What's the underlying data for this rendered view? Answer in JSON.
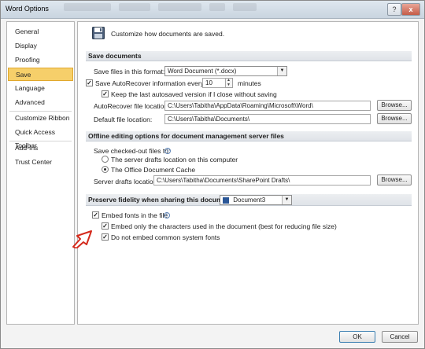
{
  "window": {
    "title": "Word Options",
    "help_label": "?",
    "close_label": "x"
  },
  "nav": {
    "items": [
      {
        "label": "General"
      },
      {
        "label": "Display"
      },
      {
        "label": "Proofing"
      },
      {
        "label": "Save",
        "selected": true
      },
      {
        "label": "Language"
      },
      {
        "label": "Advanced"
      },
      {
        "label": "Customize Ribbon"
      },
      {
        "label": "Quick Access Toolbar"
      },
      {
        "label": "Add-Ins"
      },
      {
        "label": "Trust Center"
      }
    ]
  },
  "header": {
    "icon": "save-floppy-icon",
    "text": "Customize how documents are saved."
  },
  "save_documents": {
    "section_title": "Save documents",
    "format_label": "Save files in this format:",
    "format_value": "Word Document (*.docx)",
    "autorecover_label": "Save AutoRecover information every",
    "autorecover_checked": true,
    "autorecover_minutes": "10",
    "minutes_label": "minutes",
    "keep_last_label": "Keep the last autosaved version if I close without saving",
    "keep_last_checked": true,
    "autorecover_location_label": "AutoRecover file location:",
    "autorecover_location_value": "C:\\Users\\Tabitha\\AppData\\Roaming\\Microsoft\\Word\\",
    "default_location_label": "Default file location:",
    "default_location_value": "C:\\Users\\Tabitha\\Documents\\",
    "browse_label": "Browse..."
  },
  "offline": {
    "section_title": "Offline editing options for document management server files",
    "checked_out_label": "Save checked-out files to:",
    "radio_server_label": "The server drafts location on this computer",
    "radio_cache_label": "The Office Document Cache",
    "selected": "cache",
    "drafts_label": "Server drafts location:",
    "drafts_value": "C:\\Users\\Tabitha\\Documents\\SharePoint Drafts\\",
    "browse_label": "Browse..."
  },
  "fidelity": {
    "section_title": "Preserve fidelity when sharing this document:",
    "document_value": "Document3",
    "embed_fonts_label": "Embed fonts in the file",
    "embed_fonts_checked": true,
    "embed_only_label": "Embed only the characters used in the document (best for reducing file size)",
    "embed_only_checked": true,
    "no_common_label": "Do not embed common system fonts",
    "no_common_checked": true
  },
  "footer": {
    "ok_label": "OK",
    "cancel_label": "Cancel"
  },
  "colors": {
    "selected_nav": "#f6cf6a",
    "annotation_arrow": "#d42a1c"
  }
}
